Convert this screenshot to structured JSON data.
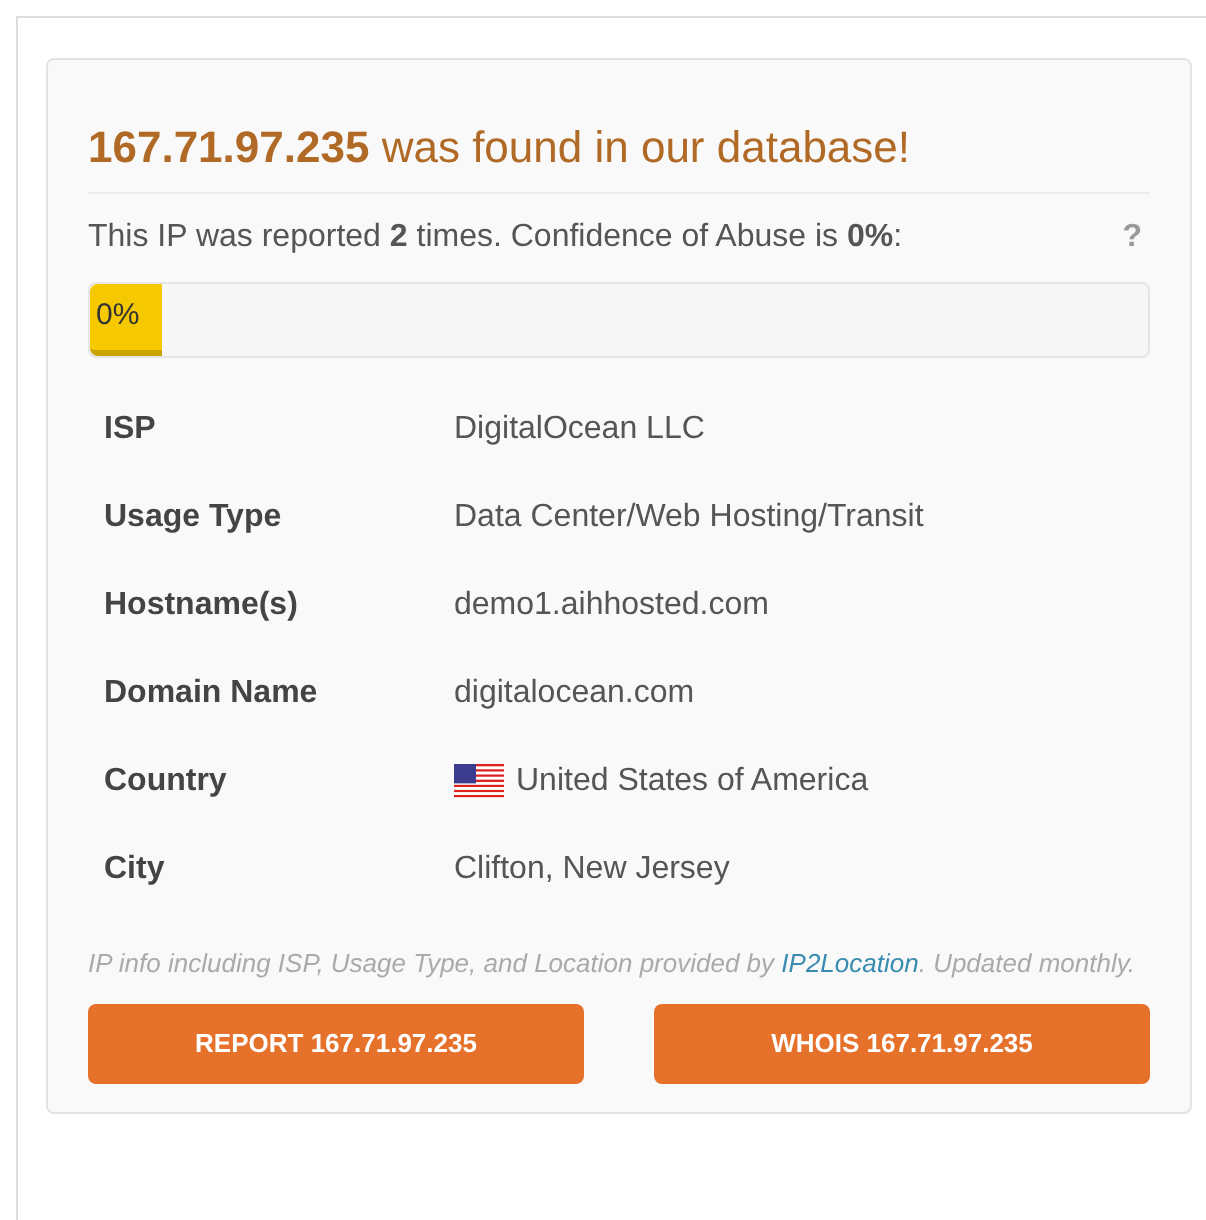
{
  "heading": {
    "ip": "167.71.97.235",
    "text": "was found in our database!"
  },
  "summary": "This IP was reported **2** times. Confidence of Abuse is **0%**:",
  "help": "?",
  "confidence": {
    "level": 0,
    "label": "0%"
  },
  "details": [
    {
      "label": "ISP",
      "value": "DigitalOcean LLC",
      "kind": "text"
    },
    {
      "label": "Usage Type",
      "value": "Data Center/Web Hosting/Transit",
      "kind": "text"
    },
    {
      "label": "Hostname(s)",
      "value": "demo1.aihhosted.com",
      "kind": "text"
    },
    {
      "label": "Domain Name",
      "value": "digitalocean.com",
      "kind": "text"
    },
    {
      "label": "Country",
      "value": "United States of America",
      "kind": "flag"
    },
    {
      "label": "City",
      "value": "Clifton, New Jersey",
      "kind": "text"
    }
  ],
  "footnote": {
    "before": "IP info including ISP, Usage Type, and Location provided by",
    "link": "IP2Location",
    "after": ". Updated monthly."
  },
  "buttons": [
    "REPORT 167.71.97.235",
    "WHOIS 167.71.97.235"
  ]
}
